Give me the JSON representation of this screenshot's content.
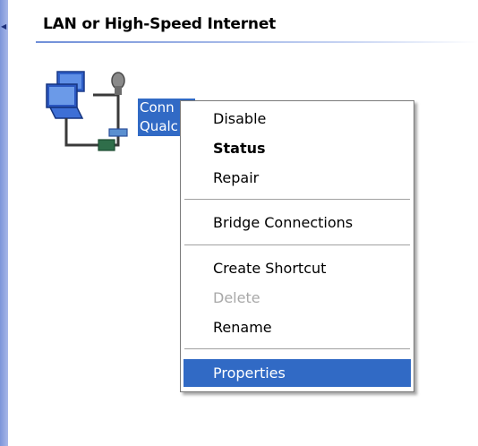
{
  "window": {
    "group_header": "LAN or High-Speed Internet"
  },
  "connection": {
    "label_line1": "Conn",
    "label_line2": "Qualc",
    "icon": "network-connection-icon"
  },
  "context_menu": {
    "items": [
      {
        "label": "Disable",
        "state": "normal"
      },
      {
        "label": "Status",
        "state": "default-bold"
      },
      {
        "label": "Repair",
        "state": "normal"
      },
      {
        "label": "Bridge Connections",
        "state": "normal"
      },
      {
        "label": "Create Shortcut",
        "state": "normal"
      },
      {
        "label": "Delete",
        "state": "disabled"
      },
      {
        "label": "Rename",
        "state": "normal"
      },
      {
        "label": "Properties",
        "state": "highlighted"
      }
    ]
  },
  "colors": {
    "selection": "#316ac5",
    "disabled_text": "#a8a8a8",
    "header_line": "#6f8ed8"
  }
}
